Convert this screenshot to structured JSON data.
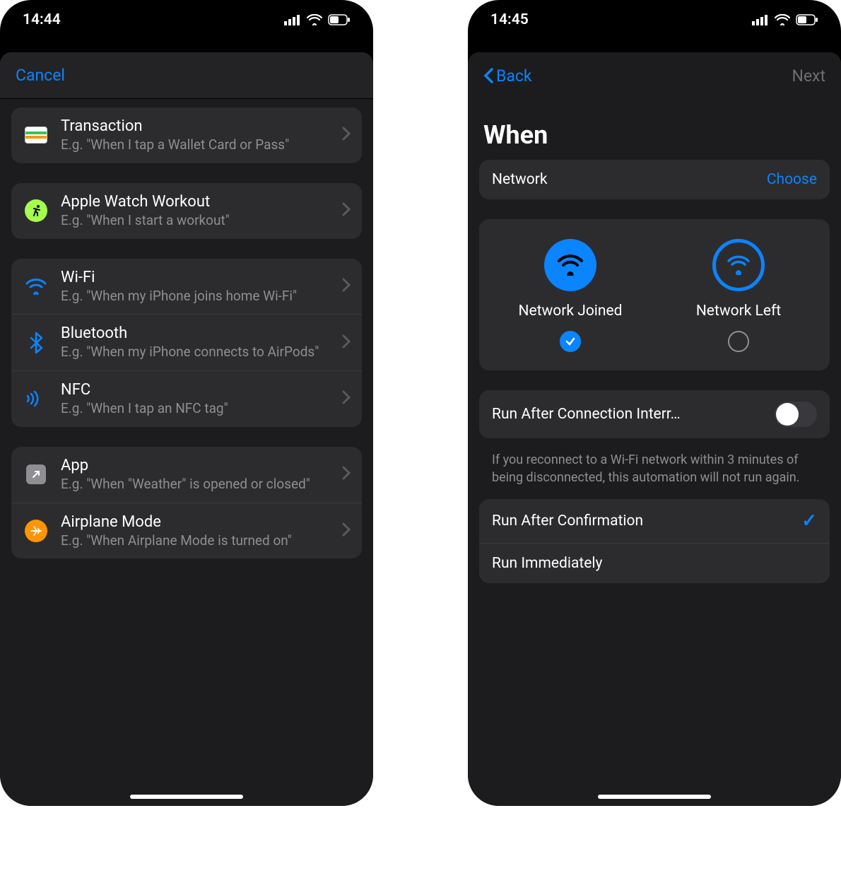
{
  "left": {
    "status_time": "14:44",
    "nav_cancel": "Cancel",
    "groups": [
      {
        "rows": [
          {
            "icon": "wallet-icon",
            "title": "Transaction",
            "subtitle": "E.g. \"When I tap a Wallet Card or Pass\""
          }
        ]
      },
      {
        "rows": [
          {
            "icon": "workout-icon",
            "title": "Apple Watch Workout",
            "subtitle": "E.g. \"When I start a workout\""
          }
        ]
      },
      {
        "rows": [
          {
            "icon": "wifi-icon",
            "title": "Wi-Fi",
            "subtitle": "E.g. \"When my iPhone joins home Wi-Fi\""
          },
          {
            "icon": "bluetooth-icon",
            "title": "Bluetooth",
            "subtitle": "E.g. \"When my iPhone connects to AirPods\""
          },
          {
            "icon": "nfc-icon",
            "title": "NFC",
            "subtitle": "E.g. \"When I tap an NFC tag\""
          }
        ]
      },
      {
        "rows": [
          {
            "icon": "app-icon",
            "title": "App",
            "subtitle": "E.g. \"When \"Weather\" is opened or closed\""
          },
          {
            "icon": "airplane-icon",
            "title": "Airplane Mode",
            "subtitle": "E.g. \"When Airplane Mode is turned on\""
          }
        ]
      }
    ]
  },
  "right": {
    "status_time": "14:45",
    "nav_back": "Back",
    "nav_next": "Next",
    "heading": "When",
    "network_row": {
      "label": "Network",
      "action": "Choose"
    },
    "options": [
      {
        "label": "Network Joined",
        "selected": true,
        "variant": "filled"
      },
      {
        "label": "Network Left",
        "selected": false,
        "variant": "outline"
      }
    ],
    "run_after_interrupt": {
      "label": "Run After Connection Interr…",
      "on": false
    },
    "interrupt_footer": "If you reconnect to a Wi-Fi network within 3 minutes of being disconnected, this automation will not run again.",
    "run_mode": [
      {
        "label": "Run After Confirmation",
        "checked": true
      },
      {
        "label": "Run Immediately",
        "checked": false
      }
    ]
  }
}
